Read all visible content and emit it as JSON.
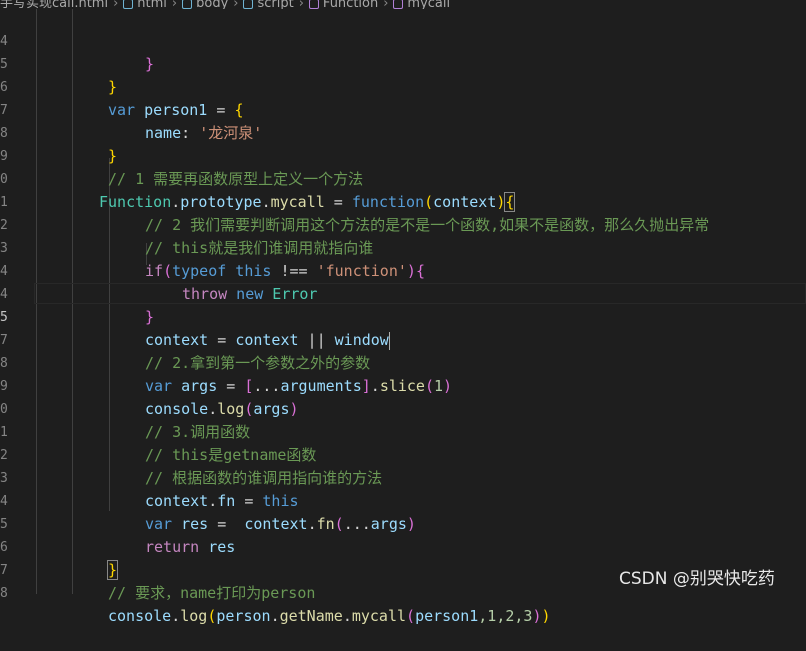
{
  "breadcrumb": {
    "items": [
      "手写实现call.html",
      "html",
      "body",
      "script",
      "Function",
      "mycall"
    ]
  },
  "line_numbers": [
    "4",
    "5",
    "6",
    "7",
    "8",
    "9",
    "0",
    "1",
    "2",
    "3",
    "4",
    "4",
    "5",
    "7",
    "8",
    "9",
    "0",
    "1",
    "2",
    "3",
    "4",
    "5",
    "6",
    "7",
    "8"
  ],
  "code": {
    "l0_brace": "}",
    "l1_brace": "}",
    "l2_var": "var",
    "l2_name": "person1",
    "l2_eq": " = ",
    "l2_open": "{",
    "l3_key": "name",
    "l3_colon": ": ",
    "l3_val": "'龙河泉'",
    "l4_close": "}",
    "l5_comment": "// 1 需要再函数原型上定义一个方法",
    "l6_cls": "Function",
    "l6_dot1": ".",
    "l6_proto": "prototype",
    "l6_dot2": ".",
    "l6_mycall": "mycall",
    "l6_eq": " = ",
    "l6_function": "function",
    "l6_popen": "(",
    "l6_param": "context",
    "l6_pclose": ")",
    "l6_bopen": "{",
    "l7_comment": "// 2 我们需要判断调用这个方法的是不是一个函数,如果不是函数，那么久抛出异常",
    "l8_comment": "// this就是我们谁调用就指向谁",
    "l9_if": "if",
    "l9_popen": "(",
    "l9_typeof": "typeof",
    "l9_this": " this",
    "l9_op": " !== ",
    "l9_str": "'function'",
    "l9_pclose": ")",
    "l9_bopen": "{",
    "l10_throw": "throw",
    "l10_new": " new",
    "l10_error": " Error",
    "l11_close": "}",
    "l12_context": "context",
    "l12_eq": " = ",
    "l12_context2": "context",
    "l12_or": " || ",
    "l12_window": "window",
    "l13_comment": "// 2.拿到第一个参数之外的参数",
    "l14_var": "var",
    "l14_args": " args",
    "l14_eq": " = ",
    "l14_bropen": "[",
    "l14_spread": "...",
    "l14_arguments": "arguments",
    "l14_brclose": "]",
    "l14_dot": ".",
    "l14_slice": "slice",
    "l14_popen": "(",
    "l14_num": "1",
    "l14_pclose": ")",
    "l15_console": "console",
    "l15_dot": ".",
    "l15_log": "log",
    "l15_popen": "(",
    "l15_args": "args",
    "l15_pclose": ")",
    "l16_comment": "// 3.调用函数",
    "l17_comment": "// this是getname函数",
    "l18_comment": "// 根据函数的谁调用指向谁的方法",
    "l19_context": "context",
    "l19_dot": ".",
    "l19_fn": "fn",
    "l19_eq": " = ",
    "l19_this": "this",
    "l20_var": "var",
    "l20_res": " res",
    "l20_eq": " =  ",
    "l20_context": "context",
    "l20_dot": ".",
    "l20_fn": "fn",
    "l20_popen": "(",
    "l20_spread": "...",
    "l20_args": "args",
    "l20_pclose": ")",
    "l21_return": "return",
    "l21_res": " res",
    "l22_close": "}",
    "l23_comment": "// 要求，name打印为person",
    "l24_console": "console",
    "l24_dot": ".",
    "l24_log": "log",
    "l24_popen": "(",
    "l24_person": "person",
    "l24_dot2": ".",
    "l24_getName": "getName",
    "l24_dot3": ".",
    "l24_mycall": "mycall",
    "l24_popen2": "(",
    "l24_person1": "person1",
    "l24_args": ",1,2,3",
    "l24_pclose2": ")",
    "l24_pclose": ")"
  },
  "watermark": "CSDN @别哭快吃药",
  "colors": {
    "background": "#1e1e1e",
    "keyword": "#569cd6",
    "variable": "#9cdcfe",
    "function": "#dcdcaa",
    "string": "#ce9178",
    "comment": "#6a9955",
    "class": "#4ec9b0"
  }
}
